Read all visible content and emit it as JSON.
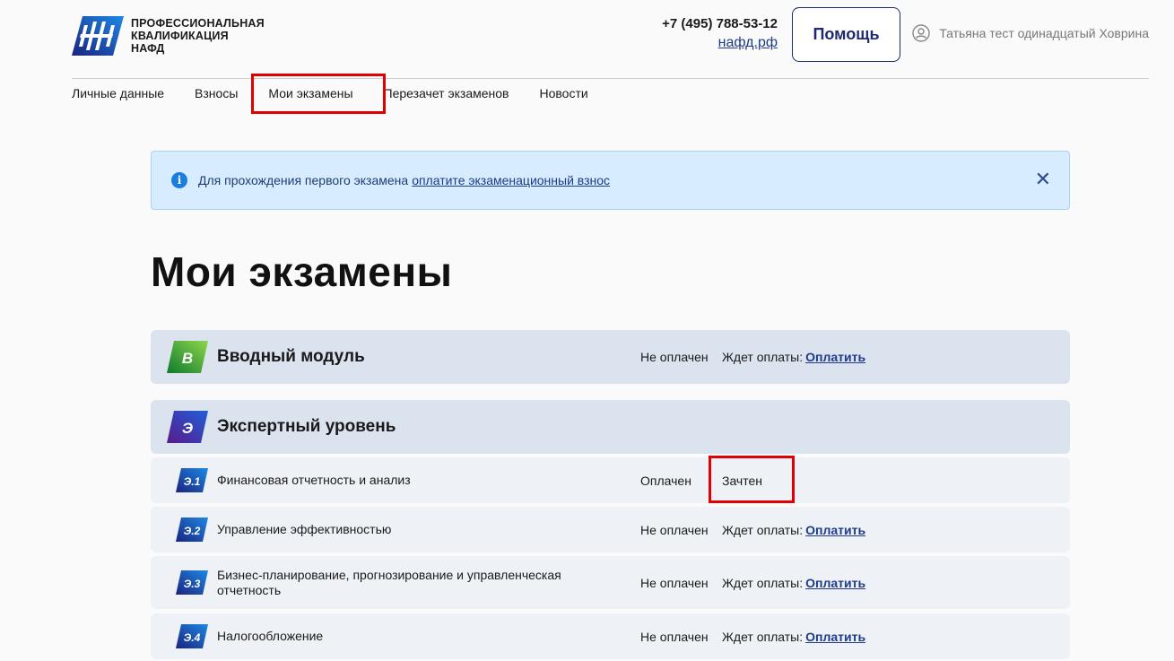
{
  "header": {
    "logo_lines": [
      "ПРОФЕССИОНАЛЬНАЯ",
      "КВАЛИФИКАЦИЯ",
      "НАФД"
    ],
    "phone": "+7 (495) 788-53-12",
    "site": "нафд.рф",
    "help_label": "Помощь",
    "user_name": "Татьяна тест одинадцатый Ховрина"
  },
  "nav": {
    "items": [
      "Личные данные",
      "Взносы",
      "Мои экзамены",
      "Перезачет экзаменов",
      "Новости"
    ],
    "active": "Мои экзамены"
  },
  "banner": {
    "text": "Для прохождения первого экзамена",
    "link": "оплатите экзаменационный взнос"
  },
  "page_title": "Мои экзамены",
  "exams": [
    {
      "badge": "В",
      "title": "Вводный модуль",
      "pay_status": "Не оплачен",
      "result_text": "Ждет оплаты:",
      "result_link": "Оплатить"
    },
    {
      "badge": "Э",
      "title": "Экспертный уровень"
    },
    {
      "badge": "Э.1",
      "title": "Финансовая отчетность и анализ",
      "pay_status": "Оплачен",
      "result_text": "Зачтен"
    },
    {
      "badge": "Э.2",
      "title": "Управление эффективностью",
      "pay_status": "Не оплачен",
      "result_text": "Ждет оплаты:",
      "result_link": "Оплатить"
    },
    {
      "badge": "Э.3",
      "title_lines": [
        "Бизнес-планирование, прогнозирование и управленческая",
        "отчетность"
      ],
      "pay_status": "Не оплачен",
      "result_text": "Ждет оплаты:",
      "result_link": "Оплатить"
    },
    {
      "badge": "Э.4",
      "title": "Налогообложение",
      "pay_status": "Не оплачен",
      "result_text": "Ждет оплаты:",
      "result_link": "Оплатить"
    }
  ],
  "colors": {
    "accent": "#1e2a6e",
    "banner_bg": "#d7ecff",
    "highlight": "#e00000",
    "intro_badge": "#2eaa3c",
    "expert_badge": "#3b2aa0"
  }
}
